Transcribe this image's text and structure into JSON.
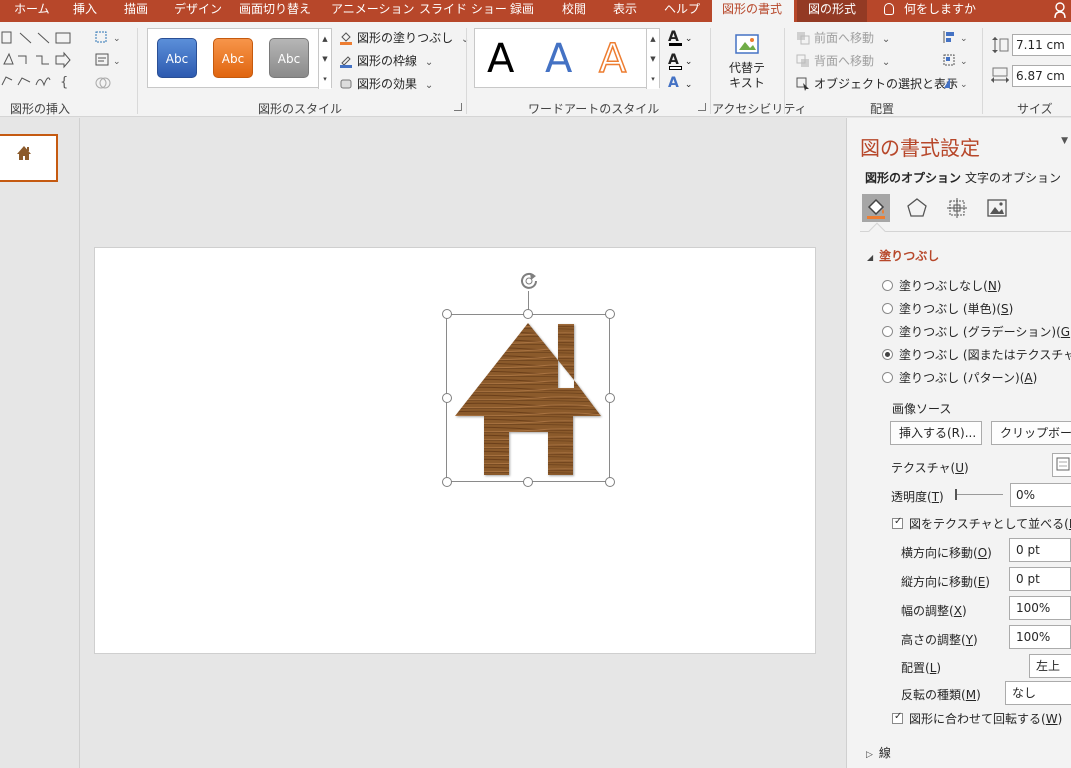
{
  "tabs": [
    {
      "label": "ホーム"
    },
    {
      "label": "挿入"
    },
    {
      "label": "描画"
    },
    {
      "label": "デザイン"
    },
    {
      "label": "画面切り替え"
    },
    {
      "label": "アニメーション"
    },
    {
      "label": "スライド ショー"
    },
    {
      "label": "録画"
    },
    {
      "label": "校閲"
    },
    {
      "label": "表示"
    },
    {
      "label": "ヘルプ"
    },
    {
      "label": "図形の書式",
      "selected": true
    },
    {
      "label": "図の形式",
      "contextual": true
    }
  ],
  "tell_me": "何をしますか",
  "ribbon": {
    "groups": {
      "insert_shapes": "図形の挿入",
      "shape_styles": "図形のスタイル",
      "wordart_styles": "ワードアートのスタイル",
      "accessibility": "アクセシビリティ",
      "arrange": "配置",
      "size": "サイズ"
    },
    "style_presets": [
      {
        "label": "Abc",
        "color": "#2d5ab0"
      },
      {
        "label": "Abc",
        "color": "#e0650f"
      },
      {
        "label": "Abc",
        "color": "#8a8a8a"
      }
    ],
    "shape_fill": "図形の塗りつぶし",
    "shape_outline": "図形の枠線",
    "shape_effects": "図形の効果",
    "wordart_samples": [
      "A",
      "A",
      "A"
    ],
    "alt_text_line1": "代替テ",
    "alt_text_line2": "キスト",
    "bring_forward": "前面へ移動",
    "send_backward": "背面へ移動",
    "selection_pane": "オブジェクトの選択と表示",
    "height": "7.11 cm",
    "width": "6.87 cm"
  },
  "format_pane": {
    "title": "図の書式設定",
    "tab_shape_options": "図形のオプション",
    "tab_text_options": "文字のオプション",
    "icons": [
      "fill-line-icon",
      "effects-icon",
      "size-properties-icon",
      "picture-icon"
    ],
    "section_fill": "塗りつぶし",
    "fill_options": [
      {
        "label": "塗りつぶしなし",
        "key": "N",
        "selected": false
      },
      {
        "label": "塗りつぶし (単色)",
        "key": "S",
        "selected": false
      },
      {
        "label": "塗りつぶし (グラデーション)",
        "key": "G",
        "selected": false
      },
      {
        "label": "塗りつぶし (図またはテクスチャ)",
        "key": "P",
        "selected": true
      },
      {
        "label": "塗りつぶし (パターン)",
        "key": "A",
        "selected": false
      }
    ],
    "image_source": "画像ソース",
    "insert_button": "挿入する(R)...",
    "clipboard_button": "クリップボード(C)",
    "texture_label": "テクスチャ",
    "texture_key": "U",
    "transparency_label": "透明度",
    "transparency_key": "T",
    "transparency_value": "0%",
    "tile_label": "図をテクスチャとして並べる",
    "tile_key": "I",
    "tile_checked": true,
    "offset_x_label": "横方向に移動",
    "offset_x_key": "O",
    "offset_x_value": "0 pt",
    "offset_y_label": "縦方向に移動",
    "offset_y_key": "E",
    "offset_y_value": "0 pt",
    "scale_x_label": "幅の調整",
    "scale_x_key": "X",
    "scale_x_value": "100%",
    "scale_y_label": "高さの調整",
    "scale_y_key": "Y",
    "scale_y_value": "100%",
    "alignment_label": "配置",
    "alignment_key": "L",
    "alignment_value": "左上",
    "mirror_label": "反転の種類",
    "mirror_key": "M",
    "mirror_value": "なし",
    "rotate_label": "図形に合わせて回転する",
    "rotate_key": "W",
    "rotate_checked": true,
    "section_line": "線"
  },
  "colors": {
    "accent": "#b7472a",
    "wood": "#8b5a2b"
  }
}
